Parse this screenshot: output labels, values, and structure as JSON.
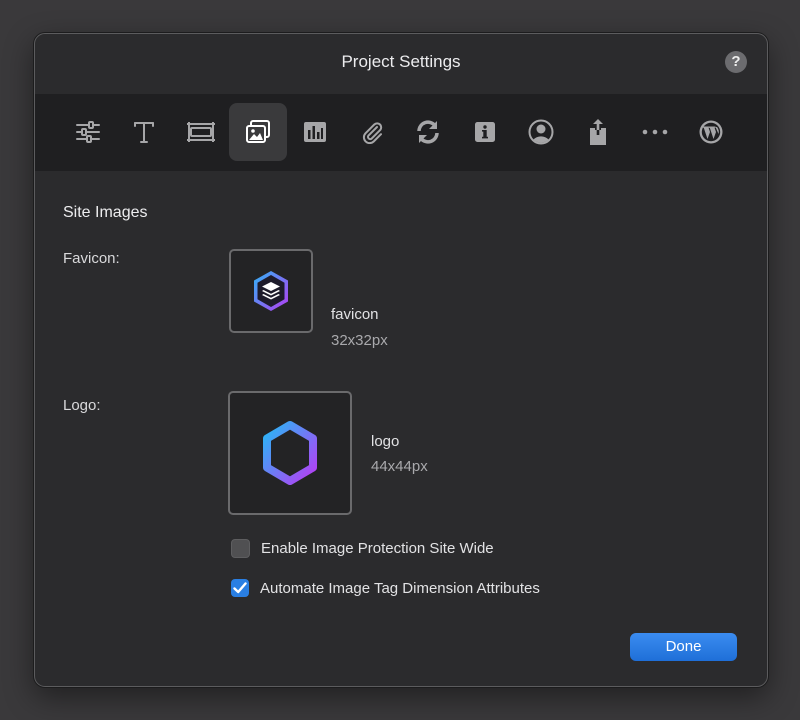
{
  "window": {
    "title": "Project Settings",
    "help_label": "?"
  },
  "toolbar": {
    "items": [
      {
        "icon": "sliders-icon"
      },
      {
        "icon": "text-icon"
      },
      {
        "icon": "layout-icon"
      },
      {
        "icon": "images-icon",
        "selected": true
      },
      {
        "icon": "chart-icon"
      },
      {
        "icon": "paperclip-icon"
      },
      {
        "icon": "sync-icon"
      },
      {
        "icon": "info-icon"
      },
      {
        "icon": "user-icon"
      },
      {
        "icon": "share-icon"
      },
      {
        "icon": "more-icon"
      },
      {
        "icon": "wordpress-icon"
      }
    ]
  },
  "site_images": {
    "section_title": "Site Images",
    "favicon": {
      "label": "Favicon:",
      "name": "favicon",
      "size": "32x32px"
    },
    "logo": {
      "label": "Logo:",
      "name": "logo",
      "size": "44x44px"
    },
    "options": [
      {
        "label": "Enable Image Protection Site Wide",
        "checked": false
      },
      {
        "label": "Automate Image Tag Dimension Attributes",
        "checked": true
      }
    ]
  },
  "footer": {
    "done_label": "Done"
  },
  "colors": {
    "accent": "#2a7fe3",
    "gradient_start": "#29b6f6",
    "gradient_end": "#b23df5"
  }
}
